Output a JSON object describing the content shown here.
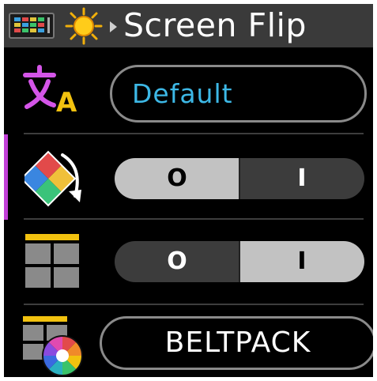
{
  "header": {
    "app_icon": "display-settings-icon",
    "category_icon": "sun-brightness-icon",
    "breadcrumb_icon": "breadcrumb-arrow-icon",
    "title": "Screen Flip"
  },
  "rows": {
    "language": {
      "icon": "translate-language-icon",
      "value": "Default"
    },
    "screen_flip": {
      "icon": "rotate-screen-icon",
      "focused": true,
      "options": [
        "O",
        "I"
      ],
      "selected": "O"
    },
    "layout": {
      "icon": "grid-layout-icon",
      "options": [
        "O",
        "I"
      ],
      "selected": "I"
    },
    "device_mode": {
      "icon": "layout-color-wheel-icon",
      "value": "BELTPACK"
    }
  },
  "colors": {
    "focus": "#c23fd8",
    "accent_text": "#3db8e6",
    "header_bg": "#3a3a3a",
    "toggle_active": "#c2c2c2",
    "toggle_inactive": "#3c3c3c"
  }
}
